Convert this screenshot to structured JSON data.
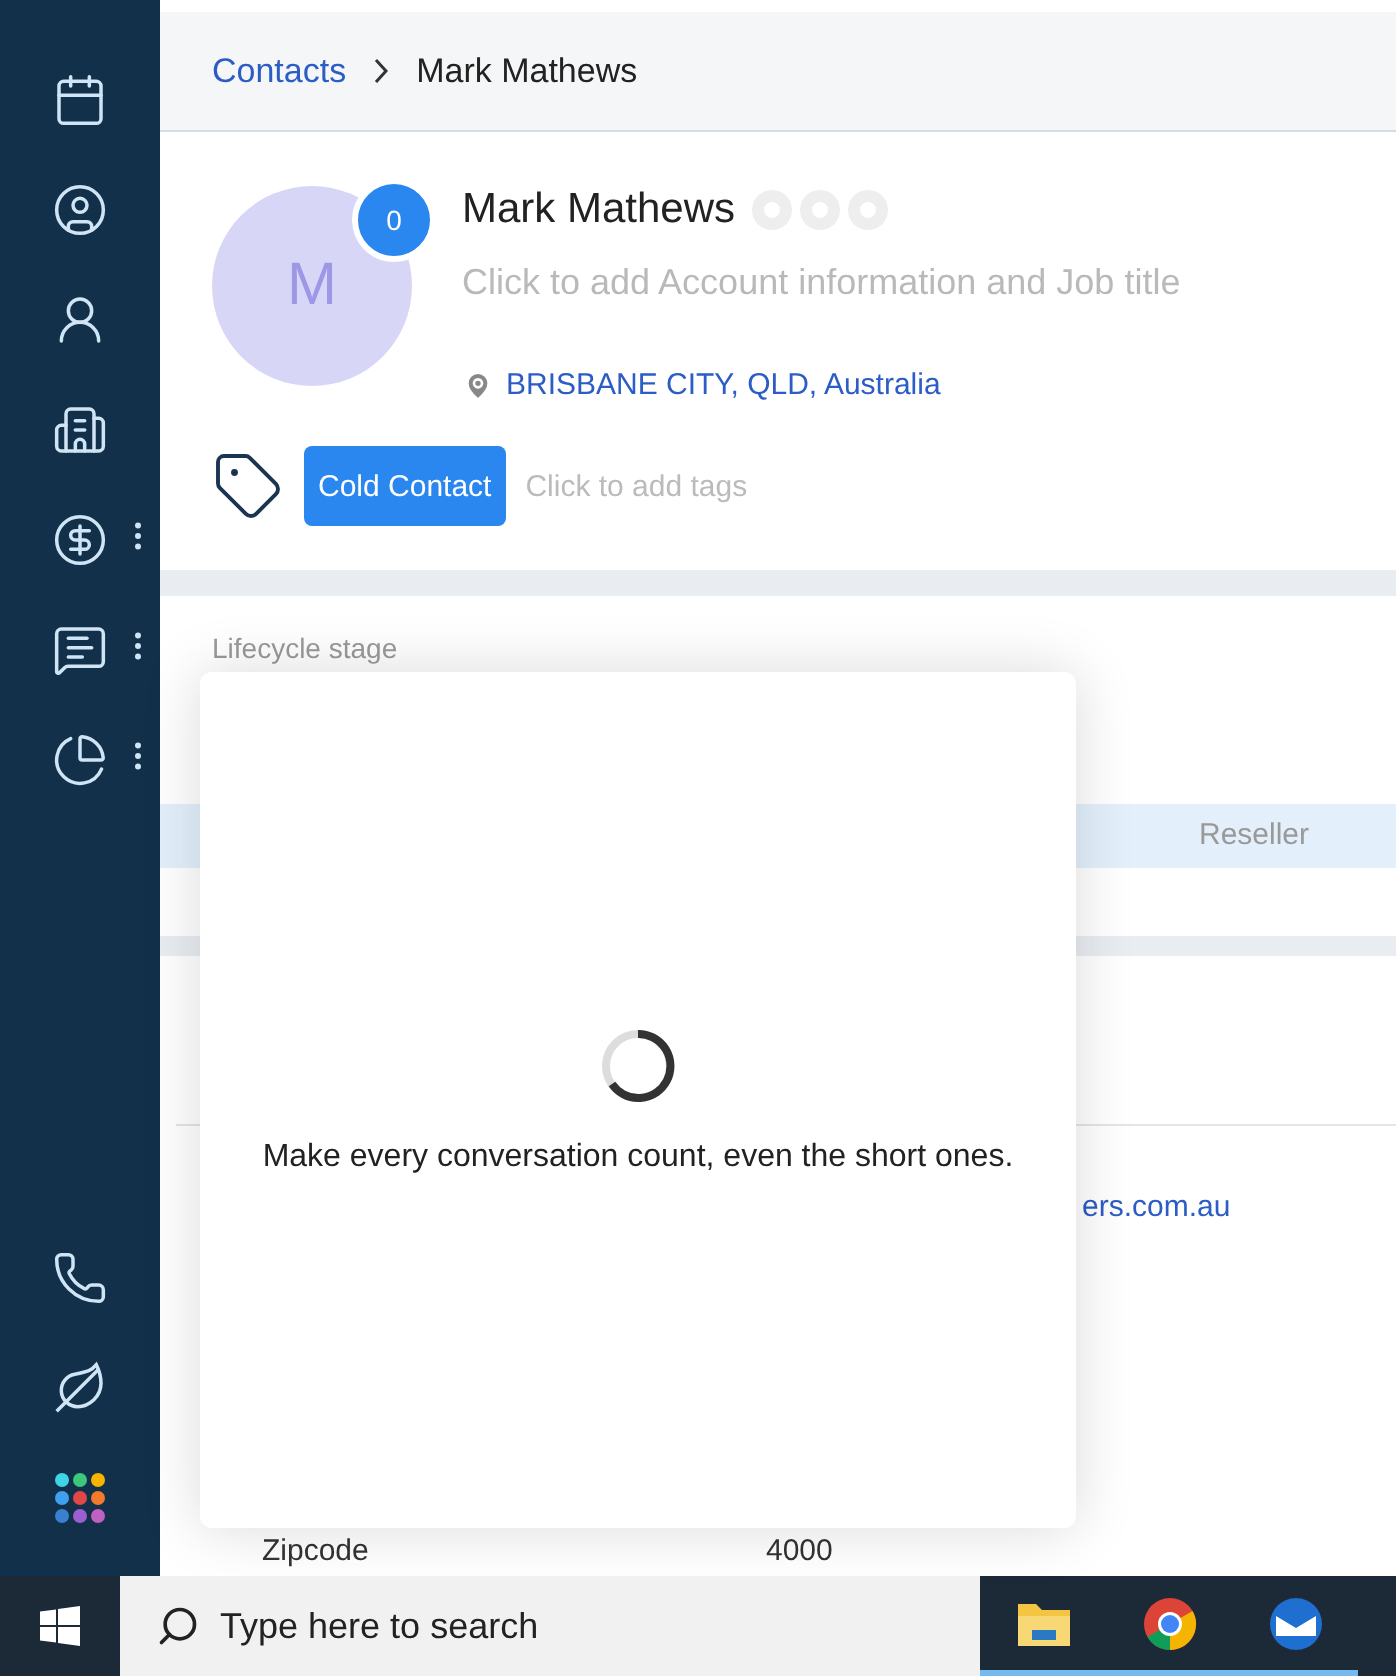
{
  "sidebar": {
    "items": [
      {
        "menu": false
      },
      {
        "menu": false
      },
      {
        "menu": false
      },
      {
        "menu": false
      },
      {
        "menu": true
      },
      {
        "menu": true
      },
      {
        "menu": true
      }
    ]
  },
  "breadcrumb": {
    "parent": "Contacts",
    "current": "Mark Mathews"
  },
  "contact": {
    "initial": "M",
    "badge": "0",
    "name": "Mark Mathews",
    "subtitle": "Click to add Account information and Job title",
    "location": "BRISBANE CITY, QLD, Australia",
    "tags": [
      {
        "label": "Cold Contact"
      }
    ],
    "tag_placeholder": "Click to add tags"
  },
  "lifecycle": {
    "label": "Lifecycle stage",
    "stage": "Reseller"
  },
  "details": {
    "email": "ers.com.au",
    "fields": [
      {
        "label": "Zipcode",
        "value": "4000"
      }
    ]
  },
  "modal": {
    "message": "Make every conversation count, even the short ones."
  },
  "taskbar": {
    "search": {
      "placeholder": "Type here to search"
    }
  }
}
